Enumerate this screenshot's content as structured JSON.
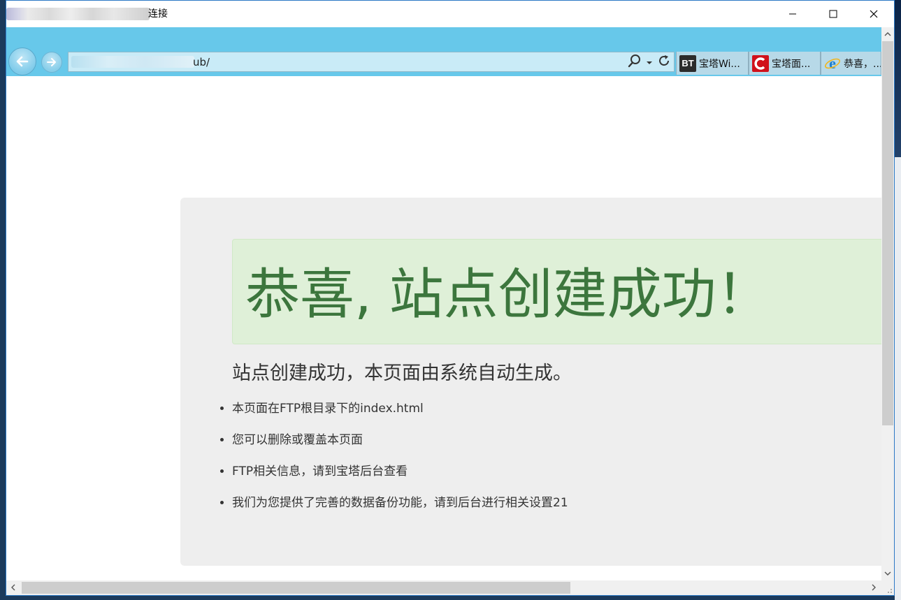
{
  "window": {
    "title_suffix": "连接",
    "minimize_icon": "minimize-icon",
    "maximize_icon": "maximize-icon",
    "close_icon": "close-icon"
  },
  "navigation": {
    "address_value": "ub/",
    "back_icon": "back-arrow-icon",
    "forward_icon": "forward-arrow-icon",
    "search_icon": "search-icon",
    "dropdown_icon": "chevron-down-icon",
    "refresh_icon": "refresh-icon"
  },
  "tabs": [
    {
      "icon_text": "BT",
      "label": "宝塔Wi..."
    },
    {
      "icon": "c-logo-icon",
      "label": "宝塔面..."
    },
    {
      "icon": "ie-logo-icon",
      "label": "恭喜，..."
    }
  ],
  "page": {
    "alert_title": "恭喜, 站点创建成功！",
    "subtitle": "站点创建成功，本页面由系统自动生成。",
    "items": [
      "本页面在FTP根目录下的index.html",
      "您可以删除或覆盖本页面",
      "FTP相关信息，请到宝塔后台查看",
      "我们为您提供了完善的数据备份功能，请到后台进行相关设置21"
    ]
  },
  "colors": {
    "nav_bar": "#67c8ea",
    "alert_bg": "#dff0d8",
    "alert_text": "#3c763d",
    "jumbotron_bg": "#eeeeee"
  }
}
